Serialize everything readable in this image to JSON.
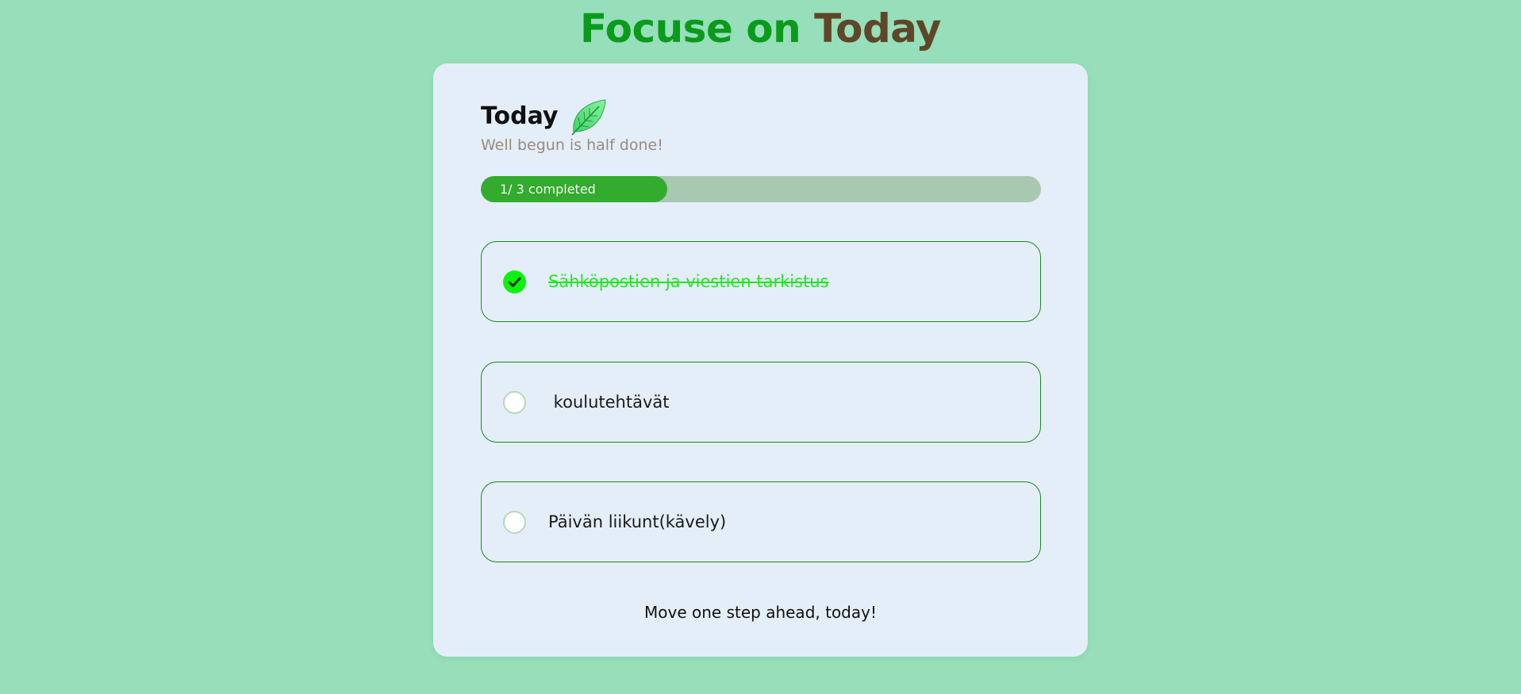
{
  "header": {
    "title_part_1": "Focuse on ",
    "title_part_2": "Today"
  },
  "card": {
    "heading": "Today",
    "heading_icon": "leaf-icon",
    "subtitle": "Well begun is half done!",
    "progress": {
      "label": "1/ 3 completed",
      "completed": 1,
      "total": 3
    },
    "tasks": [
      {
        "label": "Sähköpostien ja viestien tarkistus",
        "completed": true
      },
      {
        "label": " koulutehtävät",
        "completed": false
      },
      {
        "label": "Päivän liikunt(kävely)",
        "completed": false
      }
    ],
    "footer": "Move one step ahead, today!"
  },
  "colors": {
    "background": "#96dfba",
    "title_green": "#0b9a1b",
    "title_brown": "#5f4629",
    "progress_fill": "#33ab2e",
    "check_done": "#0cf20c"
  }
}
